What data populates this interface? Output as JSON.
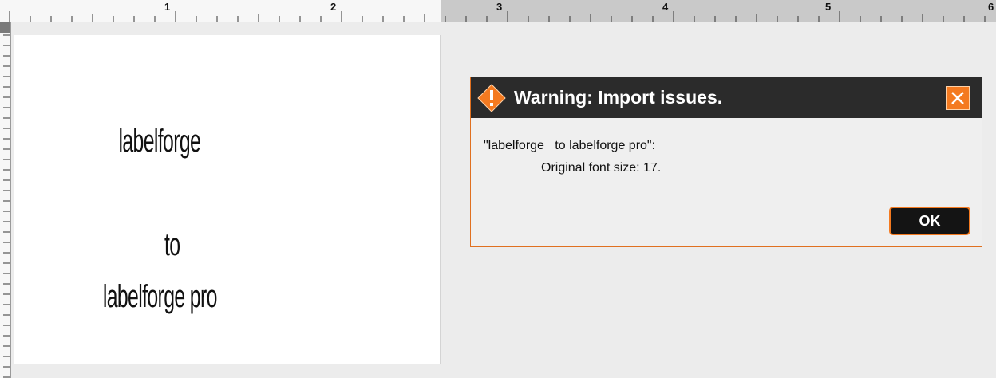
{
  "ruler": {
    "labels": [
      "1",
      "2",
      "3",
      "4",
      "5",
      "6"
    ]
  },
  "canvas": {
    "lines": [
      "labelforge",
      "to",
      "labelforge pro"
    ]
  },
  "dialog": {
    "title": "Warning: Import issues.",
    "message_line1": "\"labelforge   to labelforge pro\":",
    "message_line2": "Original font size: 17.",
    "ok_label": "OK",
    "icon": "warning-diamond-icon",
    "close_icon": "close-icon",
    "accent_color": "#f47a20",
    "titlebar_color": "#2b2b2b"
  }
}
